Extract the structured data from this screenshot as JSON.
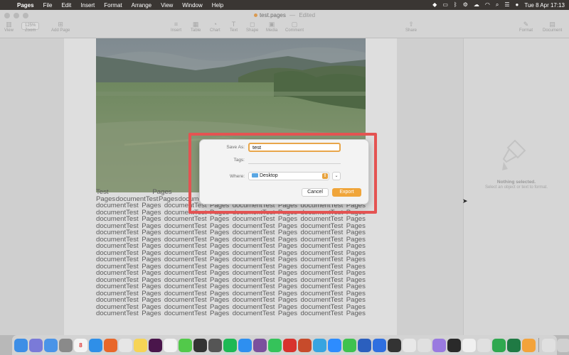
{
  "menubar": {
    "app_name": "Pages",
    "items": [
      "File",
      "Edit",
      "Insert",
      "Format",
      "Arrange",
      "View",
      "Window",
      "Help"
    ],
    "datetime": "Tue 8 Apr  17:13"
  },
  "window": {
    "title": "test.pages",
    "title_separator": "—",
    "title_status": "Edited"
  },
  "toolbar": {
    "view_label": "View",
    "zoom_value": "125%",
    "zoom_label": "Zoom",
    "add_page_label": "Add Page",
    "insert_label": "Insert",
    "table_label": "Table",
    "chart_label": "Chart",
    "text_label": "Text",
    "shape_label": "Shape",
    "media_label": "Media",
    "comment_label": "Comment",
    "share_label": "Share",
    "format_label": "Format",
    "document_label": "Document"
  },
  "document": {
    "first_line": [
      "Test",
      "Pages",
      "document",
      "Test",
      "Pages"
    ],
    "second_line": [
      "Pages",
      "documentTest",
      "Pages",
      "documentTest",
      "Pages",
      "documentTest",
      "Pages",
      "documentTest",
      "Pages"
    ],
    "repeat_line": [
      "documentTest",
      "Pages",
      "documentTest",
      "Pages",
      "documentTest",
      "Pages",
      "documentTest",
      "Pages"
    ],
    "repeat_count": 17
  },
  "inspector": {
    "title": "Nothing selected.",
    "hint": "Select an object or text to format."
  },
  "dialog": {
    "save_as_label": "Save As:",
    "save_as_value": "test",
    "tags_label": "Tags:",
    "where_label": "Where:",
    "where_value": "Desktop",
    "cancel_label": "Cancel",
    "export_label": "Export"
  },
  "colors": {
    "highlight": "#e45352",
    "accent": "#f0a53a",
    "menubar": "#3a3633"
  },
  "dock": {
    "apps": [
      {
        "name": "finder-icon",
        "color": "#3d8ee6",
        "glyph": ""
      },
      {
        "name": "launchpad-icon",
        "color": "#7a7ad8",
        "glyph": ""
      },
      {
        "name": "mail-icon",
        "color": "#4a94e8",
        "glyph": ""
      },
      {
        "name": "system-settings-icon",
        "color": "#8a8a8a",
        "glyph": ""
      },
      {
        "name": "calendar-icon",
        "color": "#f4f4f4",
        "glyph": "8"
      },
      {
        "name": "safari-icon",
        "color": "#2f8fe8",
        "glyph": ""
      },
      {
        "name": "firefox-icon",
        "color": "#e8672a",
        "glyph": ""
      },
      {
        "name": "chrome-icon",
        "color": "#e6e6e6",
        "glyph": ""
      },
      {
        "name": "notes-icon",
        "color": "#f6d456",
        "glyph": ""
      },
      {
        "name": "slack-icon",
        "color": "#4a154b",
        "glyph": ""
      },
      {
        "name": "photos-icon",
        "color": "#f2f2f2",
        "glyph": ""
      },
      {
        "name": "messages-icon",
        "color": "#52c94a",
        "glyph": ""
      },
      {
        "name": "iphone-mirroring-icon",
        "color": "#333333",
        "glyph": ""
      },
      {
        "name": "calculator-icon",
        "color": "#555555",
        "glyph": ""
      },
      {
        "name": "spotify-icon",
        "color": "#1db954",
        "glyph": ""
      },
      {
        "name": "app-store-icon",
        "color": "#2e8ff0",
        "glyph": ""
      },
      {
        "name": "viber-icon",
        "color": "#7b519d",
        "glyph": ""
      },
      {
        "name": "whatsapp-icon",
        "color": "#35c35a",
        "glyph": ""
      },
      {
        "name": "acrobat-icon",
        "color": "#d8322d",
        "glyph": ""
      },
      {
        "name": "powerpoint-icon",
        "color": "#c74b2b",
        "glyph": ""
      },
      {
        "name": "telegram-icon",
        "color": "#37a4e0",
        "glyph": ""
      },
      {
        "name": "zoom-icon",
        "color": "#2d8cff",
        "glyph": ""
      },
      {
        "name": "facetime-icon",
        "color": "#3ec24f",
        "glyph": ""
      },
      {
        "name": "word-icon",
        "color": "#2b5fbe",
        "glyph": ""
      },
      {
        "name": "dropbox-icon",
        "color": "#2f6fe0",
        "glyph": ""
      },
      {
        "name": "codeshot-icon",
        "color": "#333333",
        "glyph": ""
      },
      {
        "name": "sketch-icon",
        "color": "#e8e8e8",
        "glyph": ""
      },
      {
        "name": "imovie-icon",
        "color": "#e0e0e0",
        "glyph": ""
      },
      {
        "name": "lock-app-icon",
        "color": "#9a7ae0",
        "glyph": ""
      },
      {
        "name": "terminal-icon",
        "color": "#2a2a2a",
        "glyph": ""
      },
      {
        "name": "vectorize-icon",
        "color": "#f0f0f0",
        "glyph": ""
      },
      {
        "name": "preview-icon",
        "color": "#e0e0e0",
        "glyph": ""
      },
      {
        "name": "numbers-icon",
        "color": "#2fa84f",
        "glyph": ""
      },
      {
        "name": "excel-icon",
        "color": "#1f7a44",
        "glyph": ""
      },
      {
        "name": "pages-icon",
        "color": "#f3a33b",
        "glyph": ""
      },
      {
        "name": "downloads-icon",
        "color": "#e0e0e0",
        "glyph": ""
      },
      {
        "name": "trash-icon",
        "color": "#d0d0d0",
        "glyph": ""
      }
    ]
  }
}
